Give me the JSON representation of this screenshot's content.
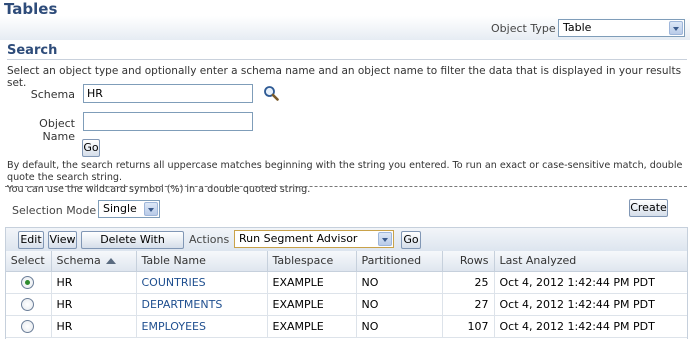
{
  "header": {
    "title": "Tables"
  },
  "object_type": {
    "label": "Object Type",
    "selected": "Table"
  },
  "search": {
    "heading": "Search",
    "instructions": "Select an object type and optionally enter a schema name and an object name to filter the data that is displayed in your results set.",
    "schema_label": "Schema",
    "schema_value": "HR",
    "object_name_label": "Object Name",
    "object_name_value": "",
    "go_label": "Go",
    "hint_line1": "By default, the search returns all uppercase matches beginning with the string you entered. To run an exact or case-sensitive match, double quote the search string.",
    "hint_line2": "You can use the wildcard symbol (%) in a double quoted string."
  },
  "selection_mode": {
    "label": "Selection Mode",
    "selected": "Single"
  },
  "create_label": "Create",
  "toolbar": {
    "edit_label": "Edit",
    "view_label": "View",
    "delete_label": "Delete With Options",
    "actions_label": "Actions",
    "actions_selected": "Run Segment Advisor",
    "go_label": "Go"
  },
  "table": {
    "columns": [
      "Select",
      "Schema",
      "Table Name",
      "Tablespace",
      "Partitioned",
      "Rows",
      "Last Analyzed"
    ],
    "rows": [
      {
        "selected": true,
        "schema": "HR",
        "name": "COUNTRIES",
        "tablespace": "EXAMPLE",
        "partitioned": "NO",
        "rows": "25",
        "last_analyzed": "Oct 4, 2012 1:42:44 PM PDT"
      },
      {
        "selected": false,
        "schema": "HR",
        "name": "DEPARTMENTS",
        "tablespace": "EXAMPLE",
        "partitioned": "NO",
        "rows": "27",
        "last_analyzed": "Oct 4, 2012 1:42:44 PM PDT"
      },
      {
        "selected": false,
        "schema": "HR",
        "name": "EMPLOYEES",
        "tablespace": "EXAMPLE",
        "partitioned": "NO",
        "rows": "107",
        "last_analyzed": "Oct 4, 2012 1:42:44 PM PDT"
      }
    ]
  },
  "colors": {
    "heading": "#2e4c7a",
    "link": "#1f4f8f",
    "selected_radio": "#2e8b2e"
  }
}
